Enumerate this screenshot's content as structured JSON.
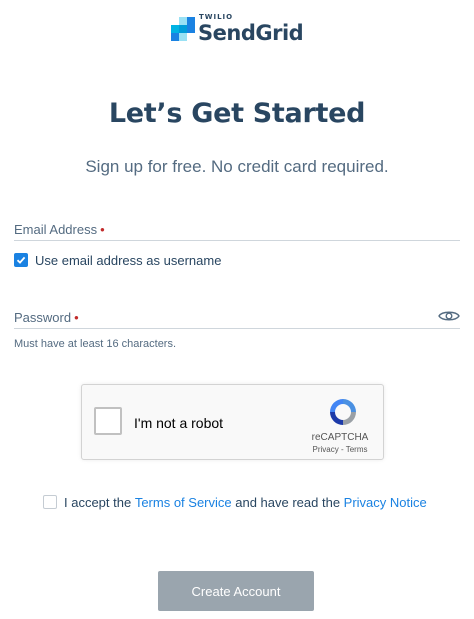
{
  "brand": {
    "top_text": "TWILIO",
    "name": "SendGrid",
    "colors": [
      "#99e1f4",
      "#00b3e3",
      "#1a82e2",
      "#009dd9"
    ]
  },
  "header": {
    "title": "Let’s Get Started",
    "subtitle": "Sign up for free. No credit card required."
  },
  "form": {
    "email_label": "Email Address",
    "required_marker": "•",
    "use_email_username_label": "Use email address as username",
    "use_email_username_checked": true,
    "password_label": "Password",
    "password_hint": "Must have at least 16 characters.",
    "show_password_icon": "eye-icon"
  },
  "captcha": {
    "label": "I'm not a robot",
    "brand": "reCAPTCHA",
    "privacy": "Privacy",
    "separator": " - ",
    "terms": "Terms"
  },
  "terms": {
    "prefix": "I accept the ",
    "tos_link": "Terms of Service",
    "middle": " and have read the ",
    "privacy_link": "Privacy Notice",
    "checked": false
  },
  "actions": {
    "create_account": "Create Account"
  },
  "colors": {
    "primary": "#1a82e2",
    "heading": "#294661",
    "required": "#c22b2b",
    "button_disabled": "#9aa5ae"
  }
}
